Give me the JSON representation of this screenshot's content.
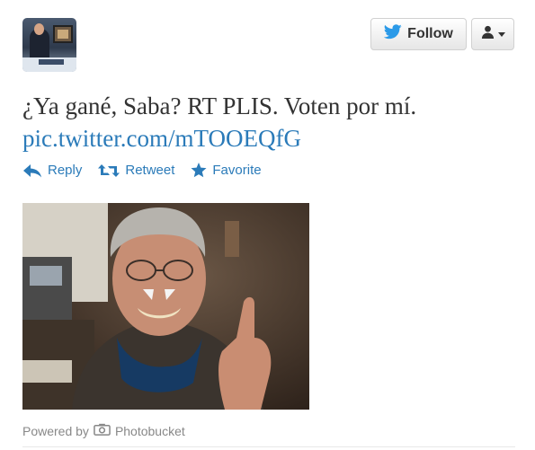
{
  "header": {
    "follow_label": "Follow"
  },
  "tweet": {
    "text": "¿Ya gané, Saba? RT PLIS. Voten por mí.",
    "link": "pic.twitter.com/mTOOEQfG"
  },
  "actions": {
    "reply_label": "Reply",
    "retweet_label": "Retweet",
    "favorite_label": "Favorite"
  },
  "media": {
    "powered_by": "Powered by",
    "provider": "Photobucket"
  },
  "colors": {
    "link": "#2b7bb9",
    "muted": "#888888"
  },
  "icons": [
    "twitter-bird-icon",
    "user-icon",
    "chevron-down-icon",
    "reply-icon",
    "retweet-icon",
    "star-icon",
    "camera-icon"
  ]
}
